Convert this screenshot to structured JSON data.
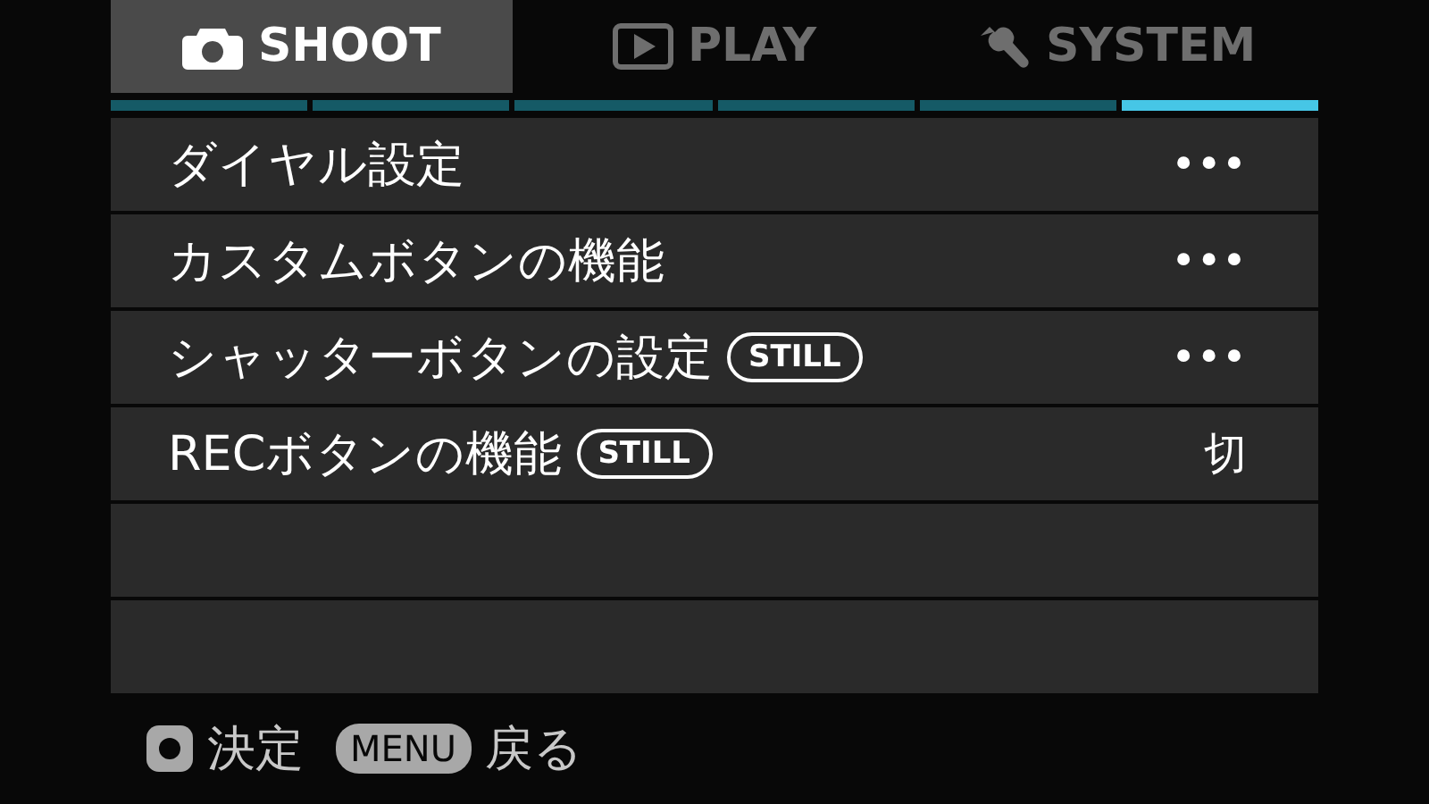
{
  "tabs": [
    {
      "label": "SHOOT",
      "kind": "camera",
      "selected": true
    },
    {
      "label": "PLAY",
      "kind": "play",
      "selected": false
    },
    {
      "label": "SYSTEM",
      "kind": "wrench",
      "selected": false
    }
  ],
  "pages": [
    {
      "selected": false
    },
    {
      "selected": false
    },
    {
      "selected": false
    },
    {
      "selected": false
    },
    {
      "selected": false
    },
    {
      "selected": true
    }
  ],
  "rows": [
    {
      "label": "ダイヤル設定",
      "value": "•••"
    },
    {
      "label": "カスタムボタンの機能",
      "value": "•••"
    },
    {
      "label": "シャッターボタンの設定",
      "badge": "STILL",
      "value": "•••"
    },
    {
      "label": "RECボタンの機能",
      "badge": "STILL",
      "value": "切"
    },
    {},
    {}
  ],
  "footer": [
    {
      "kind": "icon",
      "label": "決定"
    },
    {
      "kind": "key",
      "key": "MENU",
      "label": "戻る"
    }
  ]
}
